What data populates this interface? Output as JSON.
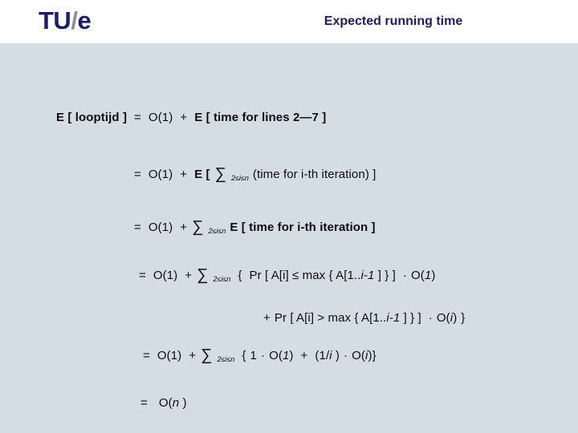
{
  "header": {
    "logo": {
      "part1": "TU",
      "slash": "/",
      "part2": "e"
    },
    "title": "Expected running time",
    "title_color": "#1c1c6e",
    "background": "#ffffff"
  },
  "slide": {
    "background": "#d4dde3",
    "text_color": "#0d0d0d"
  },
  "derivation": {
    "line1": {
      "lhs": "E [ looptijd ]",
      "eq": "=",
      "rhs_a": "O(1)",
      "plus": "+",
      "rhs_b": "E [ time for lines 2—7 ]"
    },
    "line2": {
      "eq": "=",
      "term_a": "O(1)",
      "plus": "+",
      "e_open": "E [",
      "sum": "∑",
      "sum_range": "2≤i≤n",
      "term_b": "(time for i-th iteration) ]"
    },
    "line3": {
      "eq": "=",
      "term_a": "O(1)",
      "plus": "+",
      "sum": "∑",
      "sum_range": "2≤i≤n",
      "term_b": "E [ time for i-th iteration ]"
    },
    "line4": {
      "eq": "=",
      "term_a": "O(1)",
      "plus": "+",
      "sum": "∑",
      "sum_range": "2≤i≤n",
      "brace_open": "{",
      "prob": "Pr [ A[i] ≤ max { A[1..",
      "prob_i": "i-1",
      "prob_tail": " ] }  ]",
      "dot": "·",
      "bigo": "O(",
      "bigo_arg": "1",
      "bigo_close": ")"
    },
    "line5": {
      "plus": "+",
      "prob": "Pr [ A[i] > max { A[1..",
      "prob_i": "i-1",
      "prob_tail": " ] }  ]",
      "dot": "·",
      "bigo": "O(",
      "bigo_arg": "i",
      "bigo_close": ")",
      "brace_close": "}"
    },
    "line6": {
      "eq": "=",
      "term_a": "O(1)",
      "plus": "+",
      "sum": "∑",
      "sum_range": "2≤i≤n",
      "brace_open": "{",
      "one": "1",
      "dot1": "·",
      "bigo1": "O(",
      "bigo1_arg": "1",
      "bigo1_close": ")",
      "plus2": "+",
      "frac_open": "(1/",
      "frac_i": "i",
      "frac_close": " )",
      "dot2": "·",
      "bigo2": "O(",
      "bigo2_arg": "i",
      "bigo2_close": ")",
      "brace_close": "}"
    },
    "line7": {
      "eq": "=",
      "bigo": "O(",
      "bigo_arg": "n",
      "bigo_close": " )"
    }
  }
}
